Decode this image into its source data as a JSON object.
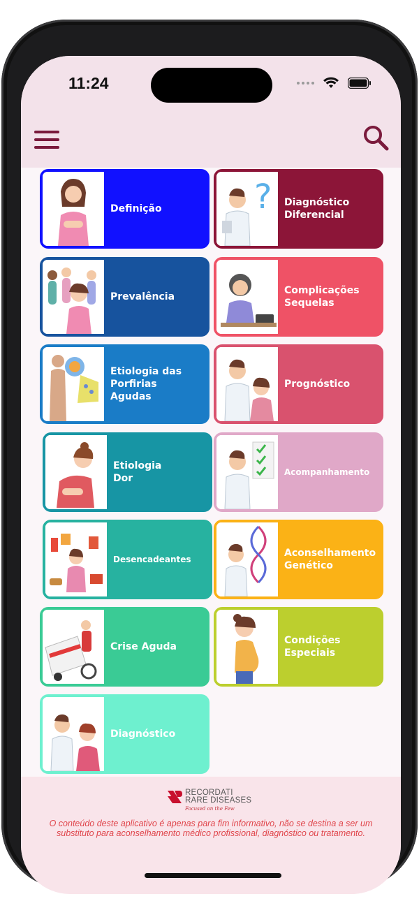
{
  "status_bar": {
    "time": "11:24"
  },
  "colors": {
    "accent": "#7a1a3c",
    "header_bg": "#f3e2ea",
    "footer_bg": "#f9e4ea",
    "disclaimer": "#e0454b"
  },
  "header": {
    "menu_icon": "hamburger-menu-icon",
    "search_icon": "search-icon"
  },
  "cards": [
    {
      "label": "Definição",
      "color": "#1111ff",
      "border": "#1111ff",
      "icon": "woman-stomach-pain-illustration"
    },
    {
      "label": "Diagnóstico\nDiferencial",
      "color": "#8c1538",
      "border": "#8c1538",
      "icon": "doctor-question-mark-illustration"
    },
    {
      "label": "Prevalência",
      "color": "#17539e",
      "border": "#17539e",
      "icon": "group-of-women-illustration"
    },
    {
      "label": "Complicações\nSequelas",
      "color": "#ef5266",
      "border": "#ef5266",
      "icon": "blood-pressure-exam-illustration"
    },
    {
      "label": "Etiologia das\nPorfirias\nAgudas",
      "color": "#1a7cc7",
      "border": "#1a7cc7",
      "icon": "body-cells-illustration"
    },
    {
      "label": "Prognóstico",
      "color": "#d9526e",
      "border": "#d9526e",
      "icon": "doctor-and-patient-illustration"
    },
    {
      "label": "Etiologia\nDor",
      "color": "#1795a4",
      "border": "#1795a4",
      "icon": "woman-abdominal-pain-illustration"
    },
    {
      "label": "Acompanhamento",
      "color": "#e0a8c8",
      "border": "#e0a8c8",
      "icon": "doctor-checklist-illustration"
    },
    {
      "label": "Desencadeantes",
      "color": "#27b2a0",
      "border": "#27b2a0",
      "icon": "triggers-food-alcohol-illustration"
    },
    {
      "label": "Aconselhamento\nGenético",
      "color": "#fbb216",
      "border": "#fbb216",
      "icon": "doctor-dna-illustration"
    },
    {
      "label": "Crise Aguda",
      "color": "#3acb95",
      "border": "#3acb95",
      "icon": "ambulance-emergency-illustration"
    },
    {
      "label": "Condições\nEspeciais",
      "color": "#bccf2e",
      "border": "#bccf2e",
      "icon": "pregnant-woman-illustration"
    },
    {
      "label": "Diagnóstico",
      "color": "#6ef0cf",
      "border": "#6ef0cf",
      "icon": "doctor-consultation-illustration"
    }
  ],
  "footer": {
    "logo_line1": "RECORDATI",
    "logo_line2": "RARE DISEASES",
    "logo_tagline": "Focused on the Few",
    "disclaimer": "O conteúdo deste aplicativo é apenas para fim informativo, não se destina a ser um substituto para aconselhamento médico profissional, diagnóstico ou tratamento."
  }
}
